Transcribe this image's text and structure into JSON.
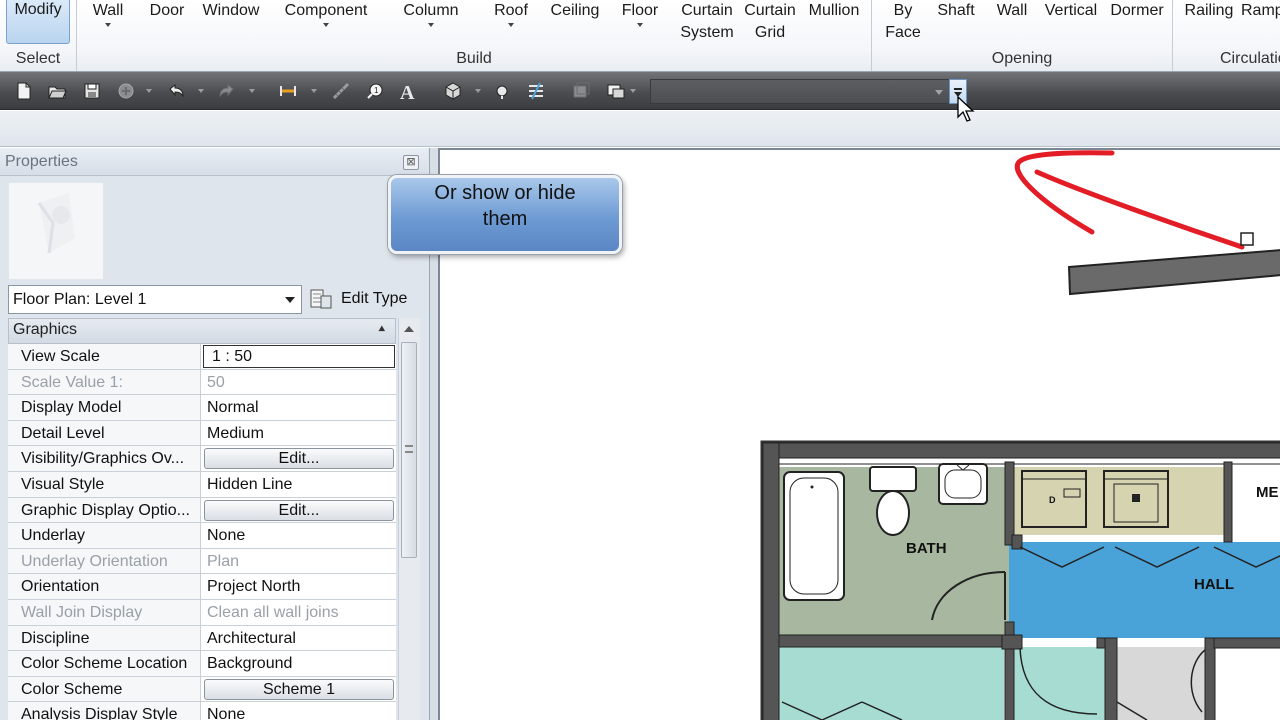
{
  "ribbon": {
    "modify": "Modify",
    "select_panel": "Select",
    "build_items": [
      {
        "label": "Wall"
      },
      {
        "label": "Door"
      },
      {
        "label": "Window"
      },
      {
        "label": "Component"
      },
      {
        "label": "Column"
      },
      {
        "label": "Roof"
      },
      {
        "label": "Ceiling"
      },
      {
        "label": "Floor"
      },
      {
        "label": "Curtain",
        "sub": "System"
      },
      {
        "label": "Curtain",
        "sub": "Grid"
      },
      {
        "label": "Mullion"
      }
    ],
    "build_panel": "Build",
    "opening_items": [
      {
        "label": "By",
        "sub": "Face"
      },
      {
        "label": "Shaft"
      },
      {
        "label": "Wall"
      },
      {
        "label": "Vertical"
      },
      {
        "label": "Dormer"
      }
    ],
    "opening_panel": "Opening",
    "circulation_items": [
      {
        "label": "Railing"
      },
      {
        "label": "Ramp"
      }
    ],
    "circulation_panel": "Circulation"
  },
  "callout": {
    "line1": "Or show or hide",
    "line2": "them"
  },
  "properties": {
    "title": "Properties",
    "close": "⊠",
    "type_selector": "Floor Plan: Level 1",
    "edit_type": "Edit Type",
    "group": "Graphics",
    "rows": [
      {
        "name": "View Scale",
        "value": "1 : 50",
        "kind": "input"
      },
      {
        "name": "Scale Value    1:",
        "value": "50",
        "kind": "dim"
      },
      {
        "name": "Display Model",
        "value": "Normal"
      },
      {
        "name": "Detail Level",
        "value": "Medium"
      },
      {
        "name": "Visibility/Graphics Ov...",
        "value": "Edit...",
        "kind": "button"
      },
      {
        "name": "Visual Style",
        "value": "Hidden Line"
      },
      {
        "name": "Graphic Display Optio...",
        "value": "Edit...",
        "kind": "button"
      },
      {
        "name": "Underlay",
        "value": "None"
      },
      {
        "name": "Underlay Orientation",
        "value": "Plan",
        "kind": "dim"
      },
      {
        "name": "Orientation",
        "value": "Project North"
      },
      {
        "name": "Wall Join Display",
        "value": "Clean all wall joins",
        "kind": "dim"
      },
      {
        "name": "Discipline",
        "value": "Architectural"
      },
      {
        "name": "Color Scheme Location",
        "value": "Background"
      },
      {
        "name": "Color Scheme",
        "value": "Scheme 1",
        "kind": "button"
      },
      {
        "name": "Analysis Display Style",
        "value": "None"
      }
    ]
  },
  "plan": {
    "rooms": {
      "bath": "BATH",
      "hall": "HALL",
      "mech": "ME"
    },
    "fixture_labels": {
      "dryer": "D"
    },
    "colors": {
      "bath": "#a8b8a0",
      "hall": "#4aa3d8",
      "laundry": "#d6d4b0",
      "lower": "#a6dcd2",
      "lower_right": "#d8d8d8",
      "wall": "#555555"
    }
  },
  "annotation": {
    "color": "#e21d26"
  }
}
